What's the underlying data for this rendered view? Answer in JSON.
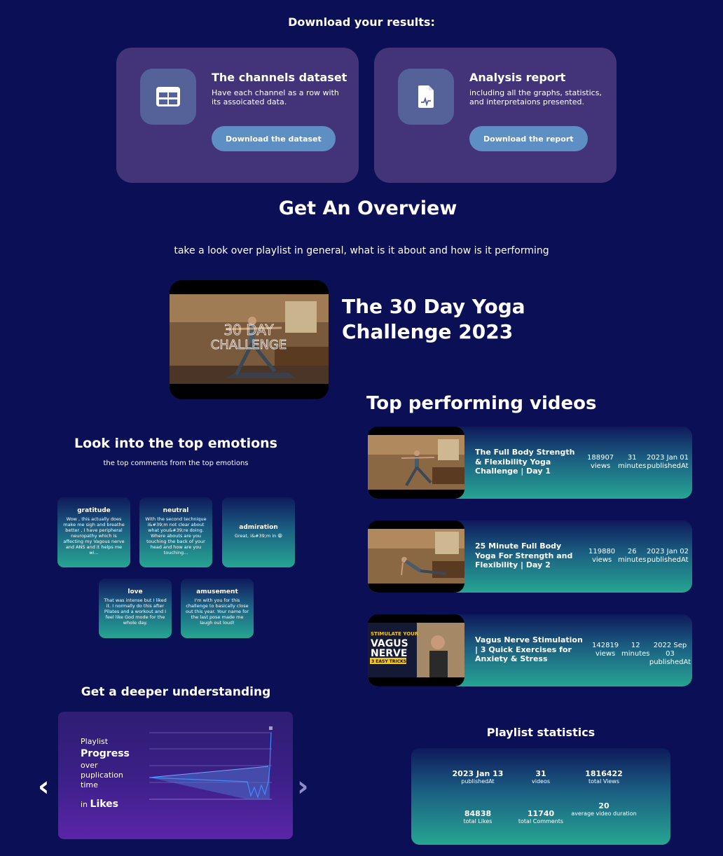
{
  "download": {
    "title": "Download your results:",
    "cards": [
      {
        "title": "The channels dataset",
        "desc": "Have each channel as a row with its assoicated data.",
        "button": "Download the dataset",
        "icon": "table-icon"
      },
      {
        "title": "Analysis report",
        "desc": "including all the graphs, statistics, and interpretaions presented.",
        "button": "Download the report",
        "icon": "report-icon"
      }
    ]
  },
  "overview": {
    "title": "Get An Overview",
    "subtitle": "take a look over playlist in general, what is it about and how is it performing",
    "playlist_title": "The 30 Day Yoga Challenge 2023",
    "thumb_text_1": "30 DAY",
    "thumb_text_2": "CHALLENGE"
  },
  "top_videos": {
    "title": "Top performing videos",
    "items": [
      {
        "title": "The Full Body Strength & Flexibility Yoga Challenge | Day 1",
        "views": "188907",
        "views_label": "views",
        "minutes": "31",
        "minutes_label": "minutes",
        "date": "2023 Jan 01",
        "date_label": "publishedAt"
      },
      {
        "title": "25 Minute Full Body Yoga For Strength and Flexibility | Day 2",
        "views": "119880",
        "views_label": "views",
        "minutes": "26",
        "minutes_label": "minutes",
        "date": "2023 Jan 02",
        "date_label": "publishedAt"
      },
      {
        "title": "Vagus Nerve Stimulation | 3 Quick Exercises for Anxiety & Stress",
        "views": "142819",
        "views_label": "views",
        "minutes": "12",
        "minutes_label": "minutes",
        "date": "2022 Sep 03",
        "date_label": "publishedAt",
        "thumb_line1": "STIMULATE YOUR",
        "thumb_line2": "VAGUS",
        "thumb_line3": "NERVE",
        "thumb_line4": "3 EASY TRICKS"
      }
    ]
  },
  "emotions": {
    "title": "Look into the top emotions",
    "subtitle": "the top comments from the top emotions",
    "items": [
      {
        "name": "gratitude",
        "comment": "Wow , this actually does make me sigh and breathe better , I have peripheral neuropathy which is affecting my Vagous nerve and ANS and it helps me wi..."
      },
      {
        "name": "neutral",
        "comment": "With the second technique i&#39;m not clear about what you&#39;re doing. Where abouts are you touching the back of your head and how are you touching..."
      },
      {
        "name": "admiration",
        "comment": "Great, i&#39;m in 😁"
      },
      {
        "name": "love",
        "comment": "That was intense but I liked it. I normally do this after Pilates and a workout and I feel like God mode for the whole day."
      },
      {
        "name": "amusement",
        "comment": "I'm with you for this challenge to basically close out this year. Your name for the last pose made me laugh out loud!"
      }
    ]
  },
  "deeper": {
    "title": "Get a deeper understanding",
    "slide_line1": "Playlist",
    "slide_line2": "Progress",
    "slide_line3": "over puplication time",
    "slide_line4a": "in",
    "slide_line4b": "Likes",
    "prev": "‹",
    "next": "›"
  },
  "stats": {
    "title": "Playlist statistics",
    "items": [
      {
        "value": "2023 Jan 13",
        "label": "publishedAt"
      },
      {
        "value": "31",
        "label": "videos"
      },
      {
        "value": "1816422",
        "label": "total Views"
      },
      {
        "value": "84838",
        "label": "total Likes"
      },
      {
        "value": "11740",
        "label": "total Comments"
      },
      {
        "value": "20",
        "label": "average video duration"
      }
    ]
  }
}
